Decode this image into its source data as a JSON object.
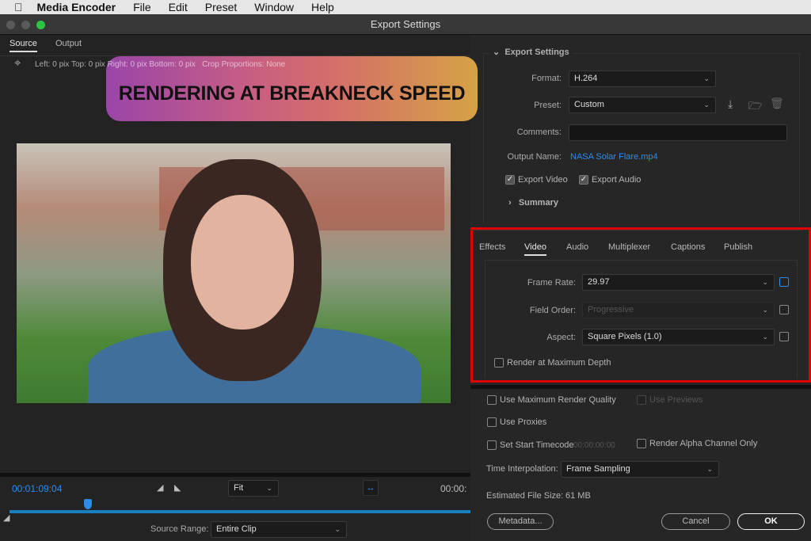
{
  "menubar": {
    "app": "Media Encoder",
    "items": [
      "File",
      "Edit",
      "Preset",
      "Window",
      "Help"
    ]
  },
  "window": {
    "title": "Export Settings"
  },
  "left": {
    "tabs": [
      "Source",
      "Output"
    ],
    "crop": {
      "left_label": "Left:",
      "left": "0",
      "top_label": "pix Top:",
      "top": "0",
      "right_label": "pix Right:",
      "right": "0",
      "bottom_label": "pix Bottom:",
      "bottom": "0",
      "unit": "pix",
      "proportions_label": "Crop Proportions:",
      "proportions": "None"
    },
    "banner": "RENDERING AT BREAKNECK SPEED",
    "timecode": "00:01:09:04",
    "timecode_end": "00:00:",
    "zoom": "Fit",
    "source_range_label": "Source Range:",
    "source_range": "Entire Clip",
    "playhead_fraction": 0.17
  },
  "export_settings": {
    "header": "Export Settings",
    "format_label": "Format:",
    "format": "H.264",
    "preset_label": "Preset:",
    "preset": "Custom",
    "comments_label": "Comments:",
    "comments": "",
    "output_name_label": "Output Name:",
    "output_name": "NASA Solar Flare.mp4",
    "export_video": "Export Video",
    "export_audio": "Export Audio",
    "summary": "Summary"
  },
  "tabs": [
    "Effects",
    "Video",
    "Audio",
    "Multiplexer",
    "Captions",
    "Publish"
  ],
  "video": {
    "frame_rate_label": "Frame Rate:",
    "frame_rate": "29.97",
    "field_order_label": "Field Order:",
    "field_order": "Progressive",
    "aspect_label": "Aspect:",
    "aspect": "Square Pixels (1.0)",
    "render_max_depth": "Render at Maximum Depth"
  },
  "bottom": {
    "max_render_quality": "Use Maximum Render Quality",
    "use_previews": "Use Previews",
    "use_proxies": "Use Proxies",
    "set_start_timecode": "Set Start Timecode",
    "start_timecode": "00:00:00:00",
    "render_alpha": "Render Alpha Channel Only",
    "time_interp_label": "Time Interpolation:",
    "time_interp": "Frame Sampling",
    "file_size_label": "Estimated File Size:",
    "file_size": "61 MB",
    "metadata": "Metadata...",
    "cancel": "Cancel",
    "ok": "OK"
  },
  "colors": {
    "accent": "#2d8ceb",
    "highlight": "#e00000"
  }
}
